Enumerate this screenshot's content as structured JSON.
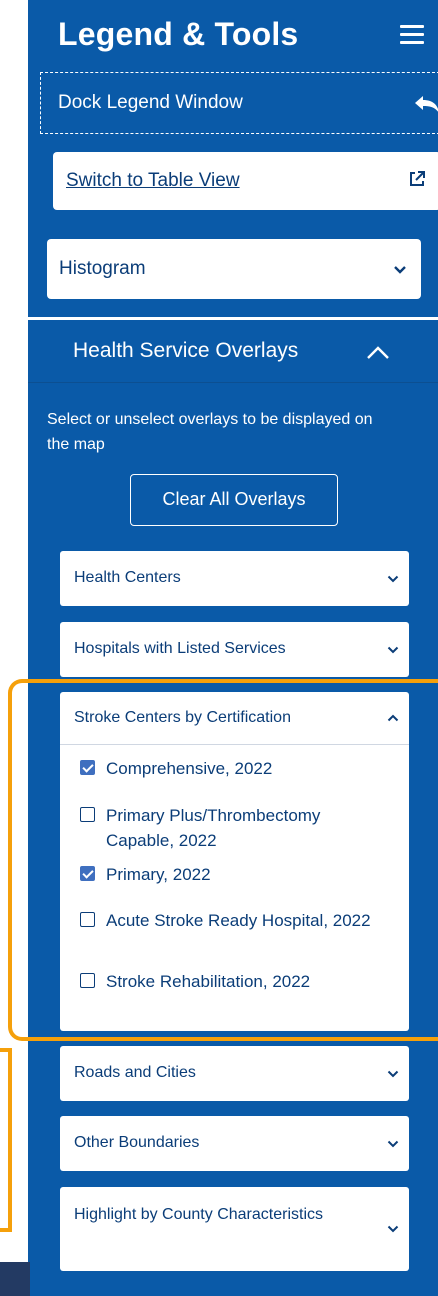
{
  "header": {
    "title": "Legend & Tools"
  },
  "dock": {
    "label": "Dock Legend Window"
  },
  "switch_view": {
    "label": "Switch to Table View"
  },
  "histogram": {
    "label": "Histogram"
  },
  "health_service_overlays": {
    "title": "Health Service Overlays",
    "instructions": "Select or unselect overlays to be displayed on the map",
    "clear_all_label": "Clear All Overlays",
    "groups": [
      {
        "label": "Health Centers",
        "expanded": false
      },
      {
        "label": "Hospitals with Listed Services",
        "expanded": false
      },
      {
        "label": "Stroke Centers by Certification",
        "expanded": true,
        "options": [
          {
            "label": "Comprehensive, 2022",
            "checked": true
          },
          {
            "label": "Primary Plus/Thrombectomy Capable, 2022",
            "checked": false
          },
          {
            "label": "Primary, 2022",
            "checked": true
          },
          {
            "label": "Acute Stroke Ready Hospital, 2022",
            "checked": false
          },
          {
            "label": "Stroke Rehabilitation, 2022",
            "checked": false
          }
        ]
      },
      {
        "label": "Roads and Cities",
        "expanded": false
      },
      {
        "label": "Other Boundaries",
        "expanded": false
      },
      {
        "label": "Highlight by County Characteristics",
        "expanded": false
      }
    ]
  },
  "colors": {
    "panel_blue": "#0a5aa8",
    "text_navy": "#0b3d78",
    "highlight_orange": "#f5a00b",
    "checkbox_checked": "#3f6fbf"
  }
}
